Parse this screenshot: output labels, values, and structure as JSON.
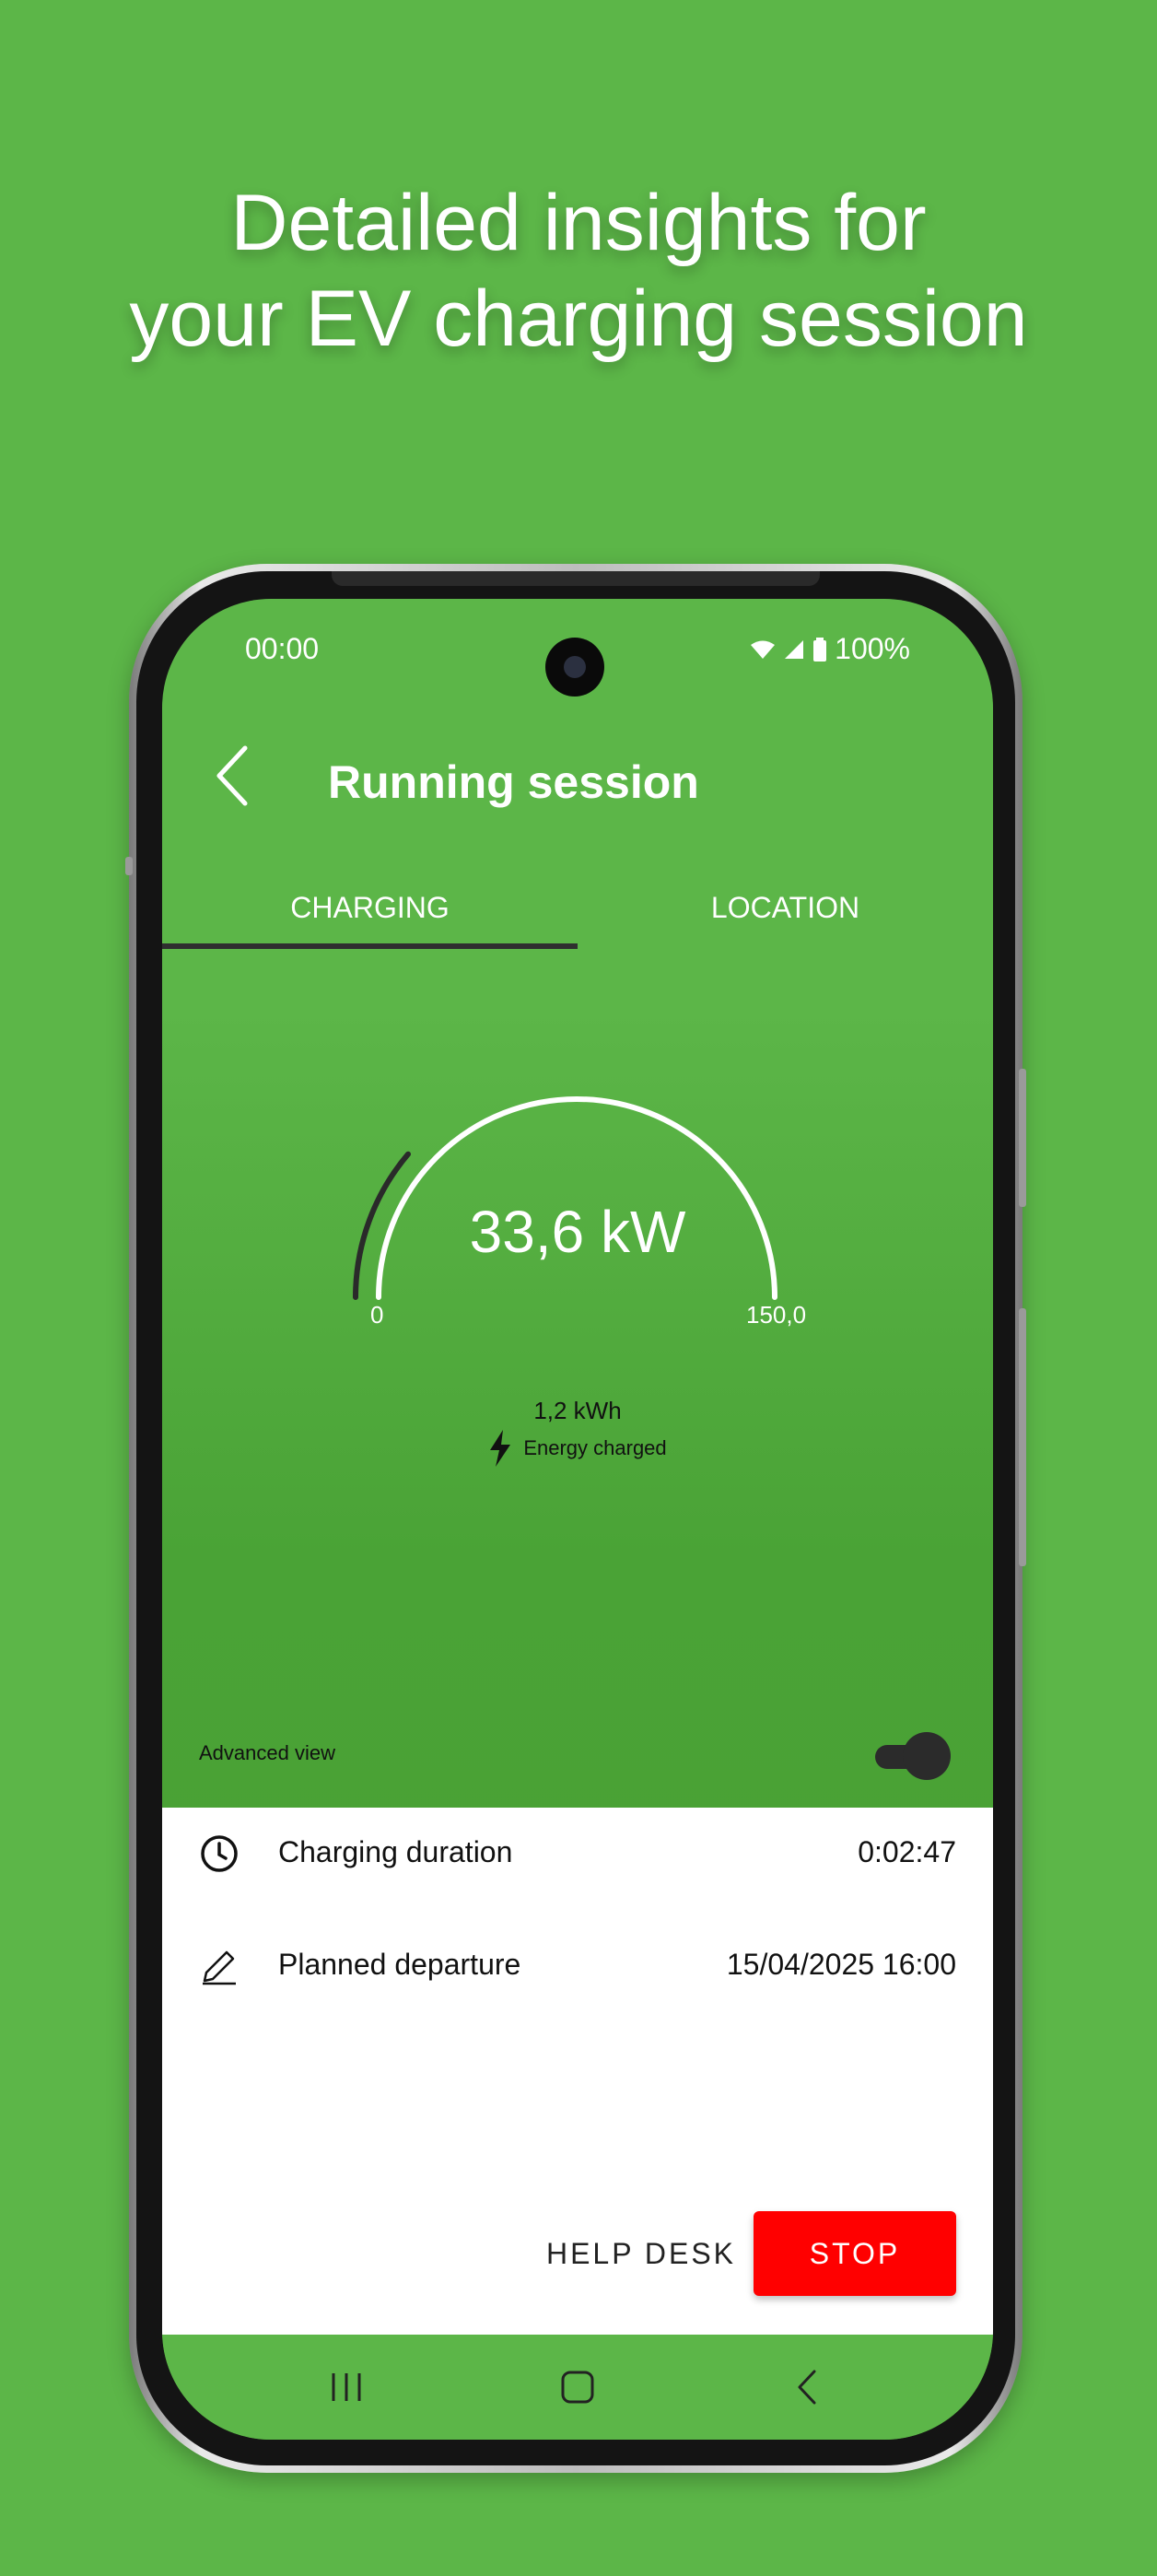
{
  "headline": {
    "line1": "Detailed insights for",
    "line2": "your EV charging session"
  },
  "status_bar": {
    "time": "00:00",
    "battery": "100%"
  },
  "app_bar": {
    "title": "Running session"
  },
  "tabs": [
    {
      "label": "CHARGING",
      "selected": true
    },
    {
      "label": "LOCATION",
      "selected": false
    }
  ],
  "gauge": {
    "power_display": "33,6 kW",
    "min_label": "0",
    "max_label": "150,0",
    "power_kw": 33.6,
    "max_kw": 150.0
  },
  "energy": {
    "value": "1,2 kWh",
    "label": "Energy charged"
  },
  "advanced_view": {
    "label": "Advanced view",
    "enabled": true
  },
  "details": [
    {
      "icon": "clock-icon",
      "label": "Charging duration",
      "value": "0:02:47"
    },
    {
      "icon": "pencil-icon",
      "label": "Planned departure",
      "value": "15/04/2025 16:00"
    }
  ],
  "actions": {
    "help_label": "HELP DESK",
    "stop_label": "STOP"
  },
  "colors": {
    "background": "#5cb648",
    "stop_button": "#ff0000",
    "panel": "#ffffff"
  }
}
